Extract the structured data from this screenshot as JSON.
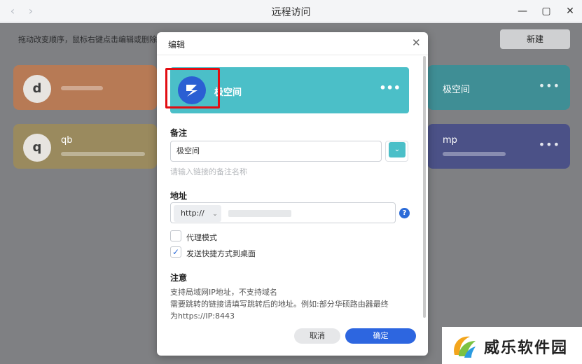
{
  "window": {
    "title": "远程访问"
  },
  "toolbar": {
    "hint": "拖动改变顺序，鼠标右键点击编辑或删除",
    "new_label": "新建"
  },
  "cards": [
    {
      "letter": "d",
      "name": "",
      "color": "#b77a55"
    },
    {
      "letter": "",
      "name": "极空间",
      "color": "#3f8e95"
    },
    {
      "letter": "q",
      "name": "qb",
      "color": "#9a8a5e"
    },
    {
      "letter": "",
      "name": "mp",
      "color": "#4b5187"
    }
  ],
  "modal": {
    "title": "编辑",
    "preview_name": "极空间",
    "preview_dots": "•••",
    "remark_label": "备注",
    "remark_value": "极空间",
    "remark_helper": "请输入链接的备注名称",
    "address_label": "地址",
    "protocol": "http://",
    "proxy_label": "代理模式",
    "proxy_checked": false,
    "shortcut_label": "发送快捷方式到桌面",
    "shortcut_checked": true,
    "note_label": "注意",
    "note_lines": [
      "支持局域网IP地址，不支持域名",
      "需要跳转的链接请填写跳转后的地址。例如:部分华硕路由器最终",
      "为https://IP:8443"
    ],
    "cancel_label": "取消",
    "ok_label": "确定"
  },
  "watermark": {
    "text": "威乐软件园"
  }
}
